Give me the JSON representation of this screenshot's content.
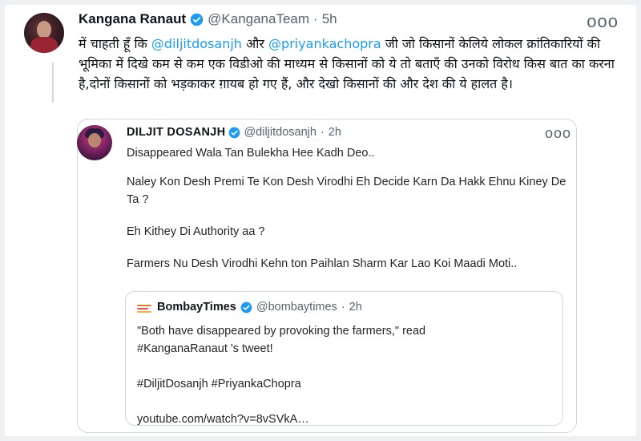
{
  "tweet": {
    "author_name": "Kangana Ranaut",
    "author_handle": "@KanganaTeam",
    "separator": "·",
    "time": "5h",
    "more": "ooo",
    "text_parts": [
      "में चाहती हूँ कि ",
      "@diljitdosanjh",
      " और ",
      "@priyankachopra",
      " जी जो किसानों केलिये लोकल क्रांतिकारियों की भूमिका में दिखे कम से कम एक विडीओ की माध्यम से किसानों को ये तो बताएँ की उनको विरोध किस बात का करना है,दोनों किसानों को भड़काकर ग़ायब हो गए हैं, और देखो किसानों की और देश की ये हालत है।"
    ]
  },
  "quoted_tweet": {
    "author_name": "DILJIT DOSANJH",
    "author_handle": "@diljitdosanjh",
    "separator": "·",
    "time": "2h",
    "more": "ooo",
    "paragraphs": [
      "Disappeared Wala Tan Bulekha Hee Kadh Deo..",
      "Naley Kon Desh Premi Te Kon Desh Virodhi Eh Decide Karn Da Hakk Ehnu Kiney De Ta ?",
      "Eh Kithey Di Authority aa ?",
      "Farmers Nu Desh Virodhi Kehn ton Paihlan Sharm Kar Lao Koi Maadi Moti.."
    ]
  },
  "nested_quote": {
    "author_name": "BombayTimes",
    "author_handle": "@bombaytimes",
    "separator": "·",
    "time": "2h",
    "paragraphs": [
      "\"Both have disappeared by provoking the farmers,\" read #KanganaRanaut 's tweet!",
      "#DiljitDosanjh #PriyankaChopra",
      "youtube.com/watch?v=8vSVkA…"
    ]
  },
  "colors": {
    "accent": "#1d9bf0",
    "text": "#0f1419",
    "muted": "#536471",
    "border": "#cfd9de"
  }
}
